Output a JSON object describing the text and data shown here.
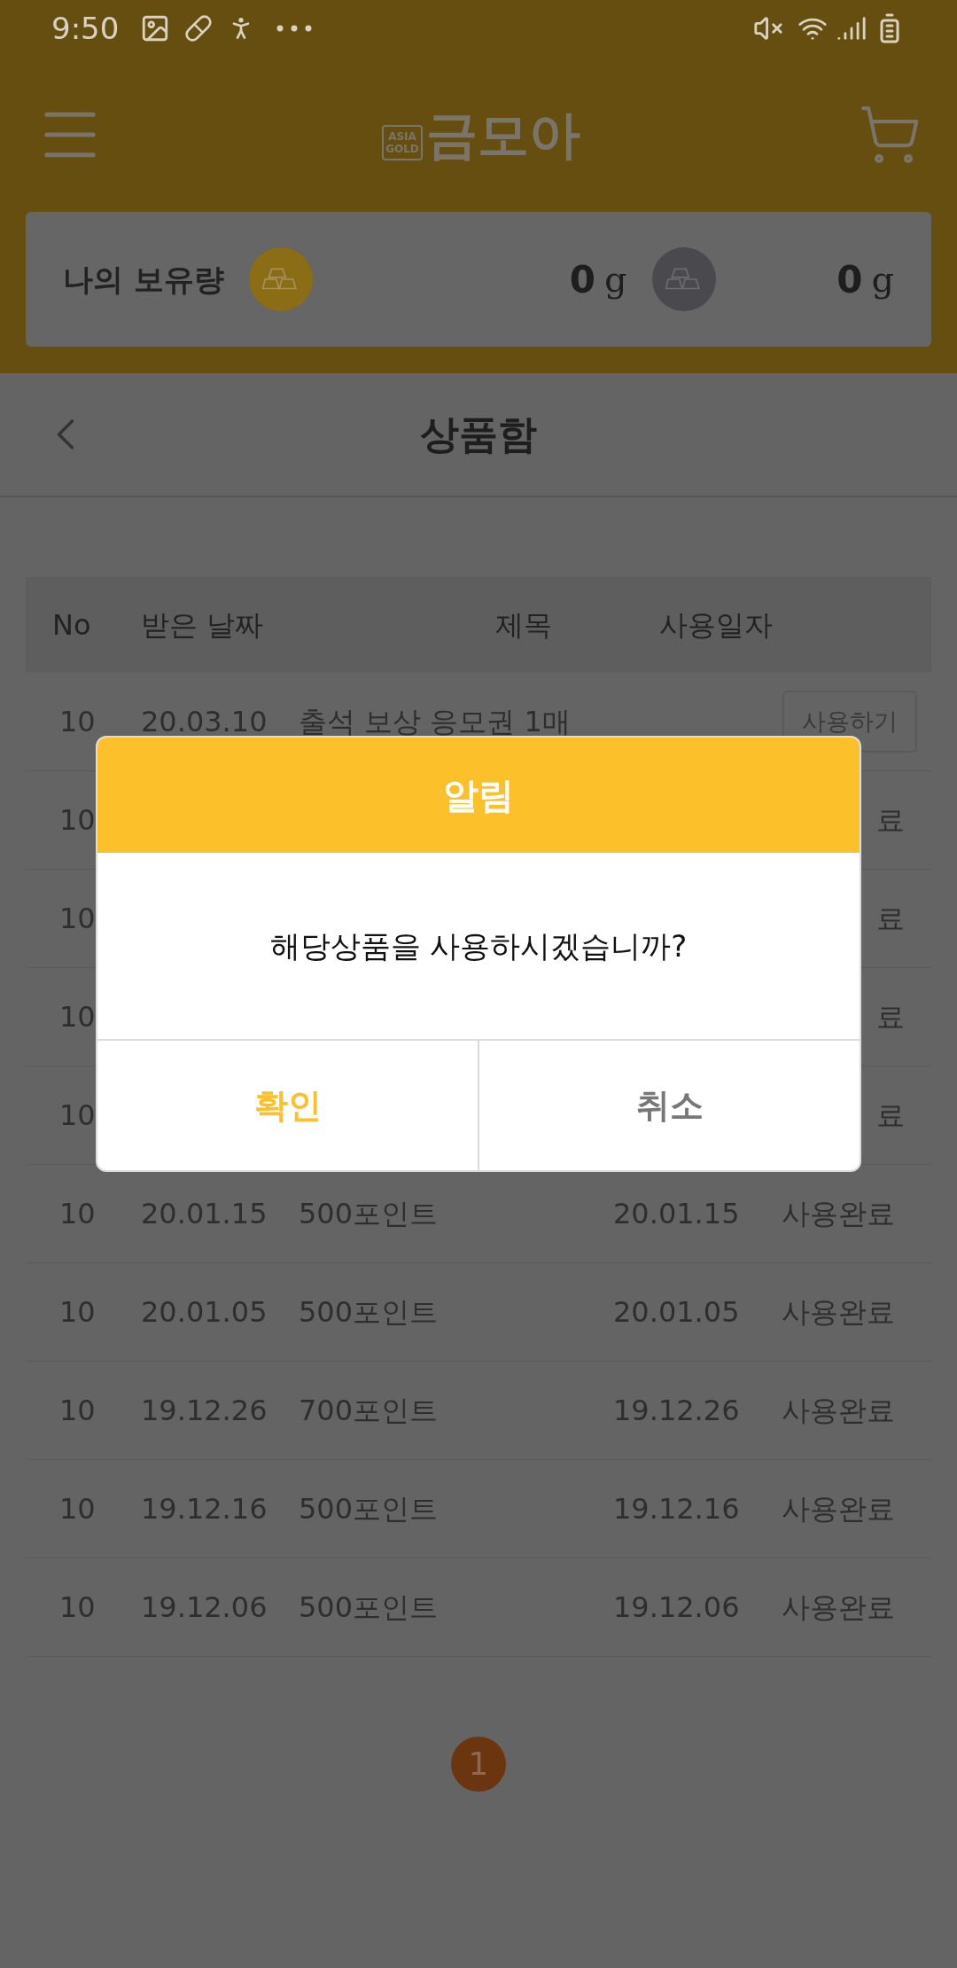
{
  "status_bar": {
    "time": "9:50"
  },
  "header": {
    "logo_badge": "ASIA GOLD",
    "logo_text": "금모아"
  },
  "holdings": {
    "label": "나의 보유량",
    "items": [
      {
        "kind": "gold",
        "amount": "0",
        "unit": "g"
      },
      {
        "kind": "silver",
        "amount": "0",
        "unit": "g"
      }
    ]
  },
  "page": {
    "title": "상품함"
  },
  "table": {
    "columns": [
      "No",
      "받은 날짜",
      "제목",
      "사용일자"
    ],
    "rows": [
      {
        "kind": "action",
        "no": "10",
        "received": "20.03.10",
        "title": "출석 보상 응모권 1매",
        "action": "사용하기"
      },
      {
        "kind": "covered",
        "no": "10",
        "status": "료"
      },
      {
        "kind": "covered",
        "no": "10",
        "status": "료"
      },
      {
        "kind": "covered",
        "no": "10",
        "status": "료"
      },
      {
        "kind": "covered",
        "no": "10",
        "status": "료"
      },
      {
        "kind": "used",
        "no": "10",
        "received": "20.01.15",
        "title": "500포인트",
        "used": "20.01.15",
        "status": "사용완료"
      },
      {
        "kind": "used",
        "no": "10",
        "received": "20.01.05",
        "title": "500포인트",
        "used": "20.01.05",
        "status": "사용완료"
      },
      {
        "kind": "used",
        "no": "10",
        "received": "19.12.26",
        "title": "700포인트",
        "used": "19.12.26",
        "status": "사용완료"
      },
      {
        "kind": "used",
        "no": "10",
        "received": "19.12.16",
        "title": "500포인트",
        "used": "19.12.16",
        "status": "사용완료"
      },
      {
        "kind": "used",
        "no": "10",
        "received": "19.12.06",
        "title": "500포인트",
        "used": "19.12.06",
        "status": "사용완료"
      }
    ]
  },
  "pagination": [
    {
      "label": "1",
      "selected": true
    }
  ],
  "dialog": {
    "title": "알림",
    "message": "해당상품을 사용하시겠습니까?",
    "buttons": [
      {
        "kind": "primary",
        "label": "확인"
      },
      {
        "kind": "secondary",
        "label": "취소"
      }
    ]
  }
}
